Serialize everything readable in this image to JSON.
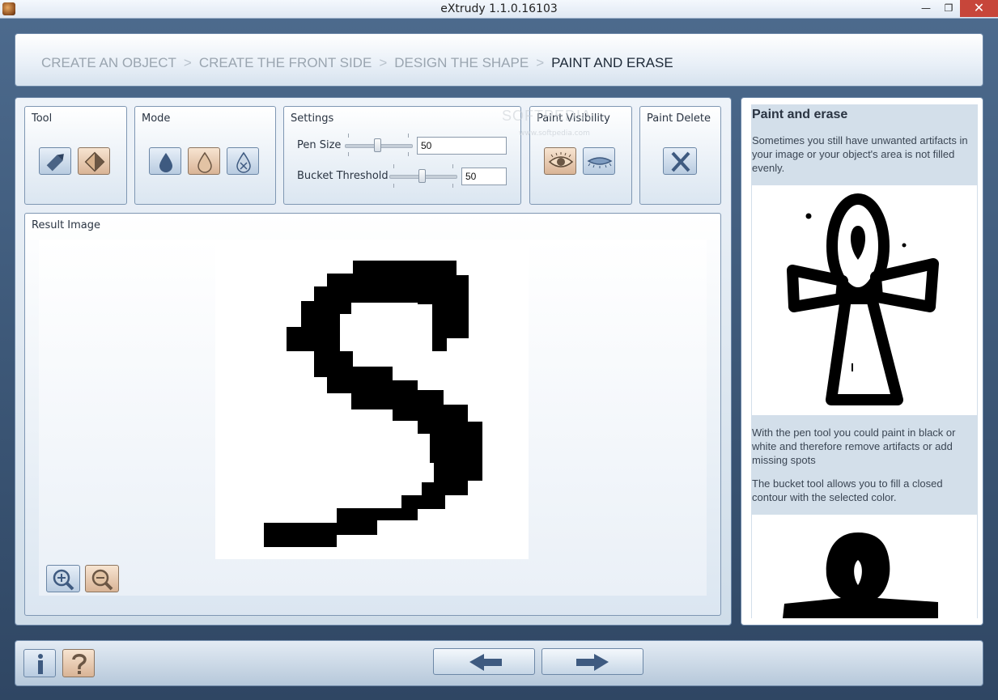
{
  "window": {
    "title": "eXtrudy 1.1.0.16103",
    "minimize": "—",
    "restore": "❐",
    "close": "✕"
  },
  "breadcrumb": {
    "steps": [
      "CREATE AN OBJECT",
      "CREATE THE FRONT SIDE",
      "DESIGN THE SHAPE",
      "PAINT AND ERASE"
    ],
    "separator": ">"
  },
  "tool_group": {
    "title": "Tool",
    "buttons": [
      {
        "icon": "pen-icon",
        "selected": false
      },
      {
        "icon": "bucket-icon",
        "selected": true
      }
    ]
  },
  "mode_group": {
    "title": "Mode",
    "buttons": [
      {
        "icon": "drop-filled-icon",
        "selected": false
      },
      {
        "icon": "drop-outline-icon",
        "selected": true
      },
      {
        "icon": "drop-erase-icon",
        "selected": false
      }
    ]
  },
  "settings": {
    "title": "Settings",
    "pen_size": {
      "label": "Pen Size",
      "value": "50",
      "level": 0.5
    },
    "bucket_threshold": {
      "label": "Bucket Threshold",
      "value": "50",
      "level": 0.5
    }
  },
  "paint_visibility": {
    "title": "Paint Visibility",
    "buttons": [
      {
        "icon": "eye-open-icon",
        "selected": true
      },
      {
        "icon": "eye-closed-icon",
        "selected": false
      }
    ]
  },
  "paint_delete": {
    "title": "Paint Delete",
    "icon": "delete-x-icon"
  },
  "result": {
    "title": "Result Image",
    "zoom_in_icon": "zoom-in-icon",
    "zoom_out_icon": "zoom-out-icon"
  },
  "watermark": {
    "text": "SOFTPEDIA",
    "sub": "www.softpedia.com"
  },
  "help": {
    "title": "Paint and erase",
    "p1": "Sometimes you still have unwanted artifacts in your image or your object's area is not filled evenly.",
    "p2": "With the pen tool you could paint in black or white and therefore remove artifacts or add missing spots",
    "p3": "The bucket tool allows you to fill a closed contour with the selected color."
  },
  "bottom": {
    "info_icon": "info-icon",
    "help_icon": "question-icon",
    "back_icon": "arrow-left-icon",
    "next_icon": "arrow-right-icon"
  },
  "colors": {
    "accent": "#4d6b8e",
    "selected_button": "#e8c9ab",
    "title_close": "#c7463a"
  }
}
